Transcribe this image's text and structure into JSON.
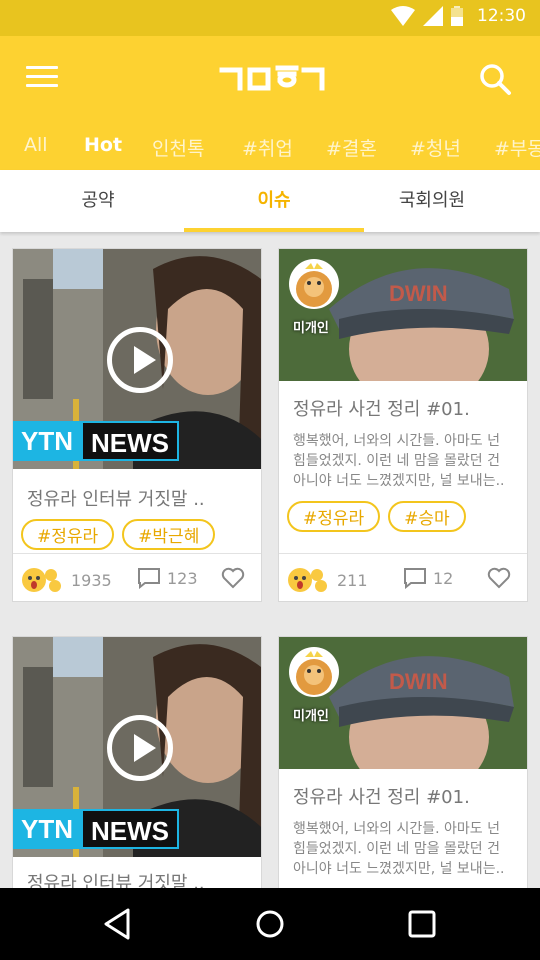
{
  "status_bar": {
    "time": "12:30"
  },
  "app_bar": {
    "logo_text": "ㄱㅁㅎㄱ"
  },
  "category_tabs": [
    "All",
    "Hot",
    "인천톡",
    "#취업",
    "#결혼",
    "#청년",
    "#부동"
  ],
  "sub_tabs": [
    "공약",
    "이슈",
    "국회의원"
  ],
  "cards": [
    {
      "title": "정유라 인터뷰 거짓말 ..",
      "tags": [
        "#정유라",
        "#박근혜"
      ],
      "reactions": "1935",
      "comments": "123",
      "badge_left": "YTN",
      "badge_right": "NEWS"
    },
    {
      "title": "정유라 사건 정리 #01.",
      "description": "행복했어, 너와의 시간들. 아마도 넌 힘들었겠지. 이런 네 맘을 몰랐던 건 아니야 너도 느꼈겠지만, 널 보내는..",
      "tags": [
        "#정유라",
        "#승마"
      ],
      "reactions": "211",
      "comments": "12",
      "avatar_label": "미개인"
    },
    {
      "title": "정유라 인터뷰 거짓말 ..",
      "badge_left": "YTN",
      "badge_right": "NEWS"
    },
    {
      "title": "정유라 사건 정리 #01.",
      "description": "행복했어, 너와의 시간들. 아마도 넌 힘들었겠지. 이런 네 맘을 몰랐던 건 아니야 너도 느꼈겠지만, 널 보내는..",
      "avatar_label": "미개인"
    }
  ],
  "colors": {
    "brand": "#fdd231",
    "status_bar": "#e8c41f",
    "accent_text": "#f5b400"
  },
  "icons": [
    "wifi-icon",
    "signal-icon",
    "battery-icon",
    "menu-icon",
    "search-icon",
    "play-icon",
    "emoji-reaction-icon",
    "comment-icon",
    "heart-icon",
    "back-icon",
    "home-icon",
    "recents-icon"
  ]
}
